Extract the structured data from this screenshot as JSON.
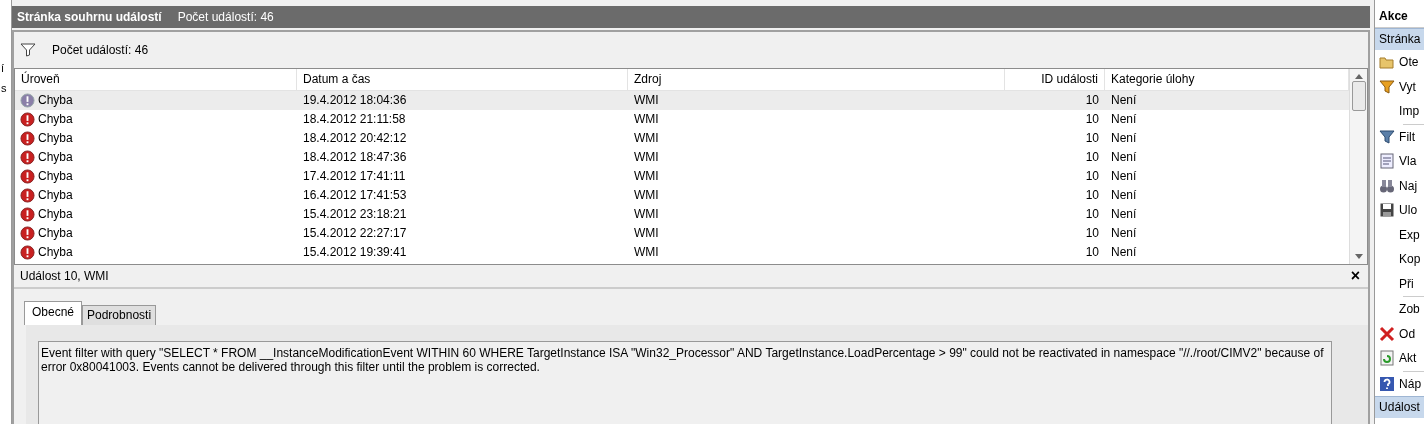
{
  "left_strip": [
    "í",
    "s"
  ],
  "title_bar": {
    "title": "Stránka souhrnu událostí",
    "count": "Počet událostí: 46"
  },
  "filter_bar": {
    "text": "Počet událostí: 46"
  },
  "table": {
    "columns": [
      "Úroveň",
      "Datum a čas",
      "Zdroj",
      "ID události",
      "Kategorie úlohy"
    ],
    "rows": [
      {
        "level_text": "Chyba",
        "date": "19.4.2012 18:04:36",
        "source": "WMI",
        "id": "10",
        "category": "Není",
        "selected": true
      },
      {
        "level_text": "Chyba",
        "date": "18.4.2012 21:11:58",
        "source": "WMI",
        "id": "10",
        "category": "Není",
        "selected": false
      },
      {
        "level_text": "Chyba",
        "date": "18.4.2012 20:42:12",
        "source": "WMI",
        "id": "10",
        "category": "Není",
        "selected": false
      },
      {
        "level_text": "Chyba",
        "date": "18.4.2012 18:47:36",
        "source": "WMI",
        "id": "10",
        "category": "Není",
        "selected": false
      },
      {
        "level_text": "Chyba",
        "date": "17.4.2012 17:41:11",
        "source": "WMI",
        "id": "10",
        "category": "Není",
        "selected": false
      },
      {
        "level_text": "Chyba",
        "date": "16.4.2012 17:41:53",
        "source": "WMI",
        "id": "10",
        "category": "Není",
        "selected": false
      },
      {
        "level_text": "Chyba",
        "date": "15.4.2012 23:18:21",
        "source": "WMI",
        "id": "10",
        "category": "Není",
        "selected": false
      },
      {
        "level_text": "Chyba",
        "date": "15.4.2012 22:27:17",
        "source": "WMI",
        "id": "10",
        "category": "Není",
        "selected": false
      },
      {
        "level_text": "Chyba",
        "date": "15.4.2012 19:39:41",
        "source": "WMI",
        "id": "10",
        "category": "Není",
        "selected": false
      }
    ]
  },
  "detail": {
    "title": "Událost 10, WMI",
    "close": "×",
    "tabs": [
      {
        "label": "Obecné",
        "selected": true
      },
      {
        "label": "Podrobnosti",
        "selected": false
      }
    ],
    "message": "Event filter with query \"SELECT * FROM __InstanceModificationEvent WITHIN 60 WHERE TargetInstance ISA \"Win32_Processor\" AND TargetInstance.LoadPercentage > 99\" could not be reactivated in namespace \"//./root/CIMV2\" because of error 0x80041003. Events cannot be delivered through this filter until the problem is corrected."
  },
  "actions": {
    "title": "Akce",
    "section": "Stránka",
    "groups": [
      [
        {
          "label": "Ote",
          "kind": "folder"
        },
        {
          "label": "Vyt",
          "kind": "create"
        },
        {
          "label": "Imp",
          "kind": "plain"
        }
      ],
      [
        {
          "label": "Filt",
          "kind": "filter"
        },
        {
          "label": "Vla",
          "kind": "properties"
        },
        {
          "label": "Naj",
          "kind": "find"
        },
        {
          "label": "Ulo",
          "kind": "save"
        },
        {
          "label": "Exp",
          "kind": "plain"
        },
        {
          "label": "Kop",
          "kind": "plain"
        },
        {
          "label": "Při",
          "kind": "plain"
        }
      ],
      [
        {
          "label": "Zob",
          "kind": "plain"
        },
        {
          "label": "Od",
          "kind": "delete"
        },
        {
          "label": "Akt",
          "kind": "refresh"
        }
      ],
      [
        {
          "label": "Náp",
          "kind": "help"
        }
      ]
    ],
    "section_2": "Událost"
  }
}
